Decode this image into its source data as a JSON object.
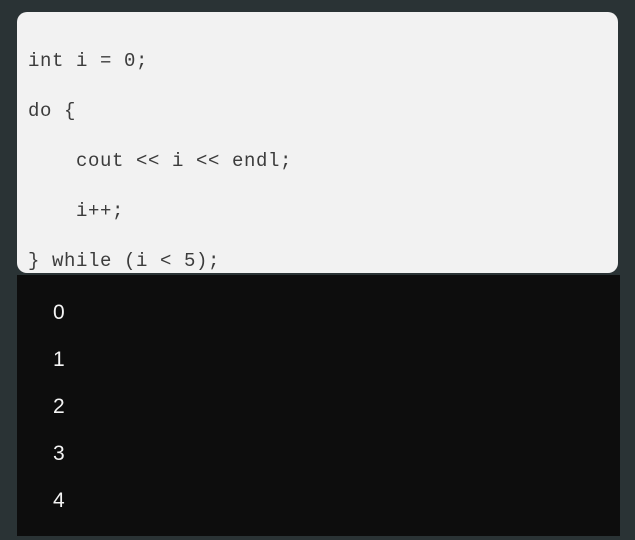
{
  "theme": {
    "page_background": "#2a3335",
    "code_panel_background": "#f2f2f2",
    "code_text_color": "#3c3c3c",
    "terminal_background": "#0d0d0d",
    "terminal_text_color": "#f4f4f4"
  },
  "code_panel": {
    "language": "cpp",
    "lines": [
      "int i = 0;",
      "do {",
      "    cout << i << endl;",
      "    i++;",
      "} while (i < 5);"
    ]
  },
  "output_panel": {
    "lines": [
      "0",
      "1",
      "2",
      "3",
      "4"
    ]
  }
}
